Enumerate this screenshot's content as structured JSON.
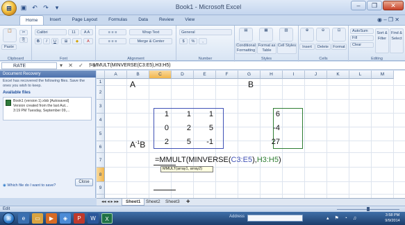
{
  "window": {
    "title": "Book1 - Microsoft Excel",
    "office_logo": "office-logo-icon"
  },
  "qat": [
    "save-icon",
    "undo-icon",
    "redo-icon"
  ],
  "tabs": [
    {
      "label": "Home",
      "active": true
    },
    {
      "label": "Insert"
    },
    {
      "label": "Page Layout"
    },
    {
      "label": "Formulas"
    },
    {
      "label": "Data"
    },
    {
      "label": "Review"
    },
    {
      "label": "View"
    }
  ],
  "ribbon": {
    "groups": [
      {
        "label": "Clipboard",
        "items": [
          "Paste"
        ]
      },
      {
        "label": "Font",
        "items": [
          "Calibri",
          "11",
          "B",
          "I",
          "U"
        ]
      },
      {
        "label": "Alignment",
        "items": [
          "Wrap Text",
          "Merge & Center"
        ]
      },
      {
        "label": "Number",
        "items": [
          "General",
          "$",
          "%"
        ]
      },
      {
        "label": "Styles",
        "items": [
          "Conditional Formatting",
          "Format as Table",
          "Cell Styles"
        ]
      },
      {
        "label": "Cells",
        "items": [
          "Insert",
          "Delete",
          "Format"
        ]
      },
      {
        "label": "Editing",
        "items": [
          "AutoSum",
          "Fill",
          "Clear",
          "Sort & Filter",
          "Find & Select"
        ]
      }
    ]
  },
  "formula_bar": {
    "name_box": "RATE",
    "fx_buttons": "▾ ✕ ✓ fx",
    "formula": "=MMULT(MINVERSE(C3:E5),H3:H5)"
  },
  "recovery": {
    "title": "Document Recovery",
    "message": "Excel has recovered the following files. Save the ones you wish to keep.",
    "available_label": "Available files",
    "file": {
      "line1": "Book1 (version 1).xlsb [Autosaved]",
      "line2": "Version created from the last Aut...",
      "line3": "3:19 PM Tuesday, September 09,..."
    },
    "which_link": "Which file do I want to save?",
    "close_label": "Close"
  },
  "grid": {
    "columns": [
      "A",
      "B",
      "C",
      "D",
      "E",
      "F",
      "G",
      "H",
      "I",
      "J",
      "K",
      "L",
      "M"
    ],
    "selected_column": "C",
    "rows": [
      "1",
      "2",
      "3",
      "4",
      "5",
      "6",
      "7",
      "8",
      "9",
      "10",
      "11"
    ],
    "selected_row": "8",
    "label_A": "A",
    "label_B": "B",
    "label_AinvB_base": "A",
    "label_AinvB_exp": "-1",
    "label_AinvB_tail": "B",
    "matrix_A": [
      [
        "1",
        "1",
        "1"
      ],
      [
        "0",
        "2",
        "5"
      ],
      [
        "2",
        "5",
        "-1"
      ]
    ],
    "vector_B": [
      "6",
      "-4",
      "27"
    ],
    "formula_prefix": "=MMULT(MINVERSE(",
    "formula_ref1": "C3:E5",
    "formula_mid": "),",
    "formula_ref2": "H3:H5",
    "formula_suffix": ")",
    "tooltip": "MMULT(array1, array2)"
  },
  "sheets": [
    {
      "label": "Sheet1",
      "active": true
    },
    {
      "label": "Sheet2"
    },
    {
      "label": "Sheet3"
    }
  ],
  "status": {
    "mode": "Edit"
  },
  "taskbar": {
    "address_label": "Address",
    "time": "3:58 PM",
    "date": "9/9/2014"
  },
  "colors": {
    "ref1": "#3f51b5",
    "ref2": "#2e7d32"
  }
}
